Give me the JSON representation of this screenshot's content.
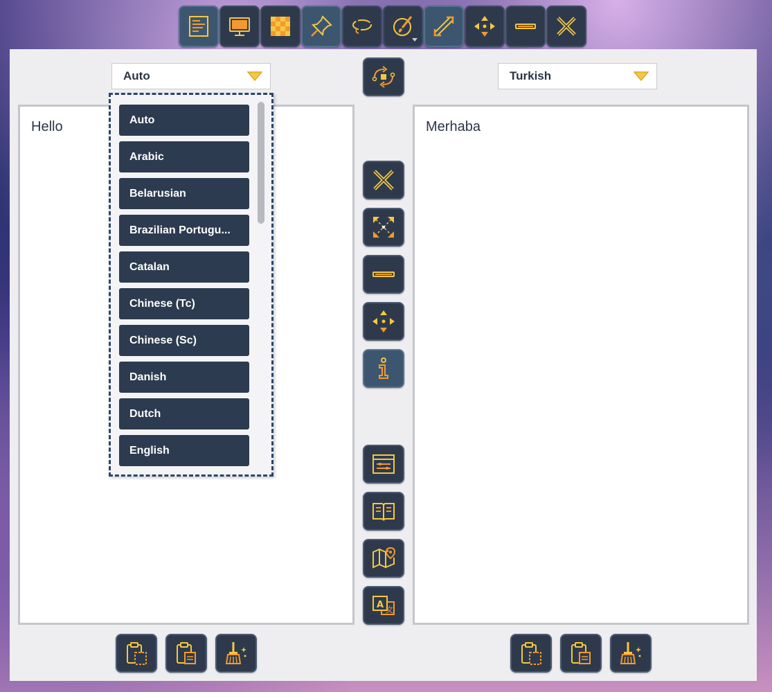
{
  "toolbar": {
    "buttons": [
      {
        "icon": "document-list-icon",
        "active": true
      },
      {
        "icon": "monitor-icon",
        "active": false
      },
      {
        "icon": "checkerboard-icon",
        "active": false
      },
      {
        "icon": "pin-icon",
        "active": true
      },
      {
        "icon": "lasso-icon",
        "active": false
      },
      {
        "icon": "brush-palette-icon",
        "active": false,
        "has_dropdown": true
      },
      {
        "icon": "resize-diagonal-icon",
        "active": true
      },
      {
        "icon": "move-arrows-icon",
        "active": false
      },
      {
        "icon": "minimize-icon",
        "active": false
      },
      {
        "icon": "close-icon",
        "active": false
      }
    ]
  },
  "source": {
    "language": "Auto",
    "text": "Hello"
  },
  "target": {
    "language": "Turkish",
    "text": "Merhaba"
  },
  "dropdown": {
    "items": [
      "Auto",
      "Arabic",
      "Belarusian",
      "Brazilian Portugu...",
      "Catalan",
      "Chinese (Tc)",
      "Chinese (Sc)",
      "Danish",
      "Dutch",
      "English"
    ],
    "scroll_fraction": 0.0
  },
  "colors": {
    "accent_yellow": "#f5c842",
    "accent_orange": "#f39a2e",
    "button_bg": "#2e3a4c",
    "dropdown_border": "#2b456b"
  }
}
